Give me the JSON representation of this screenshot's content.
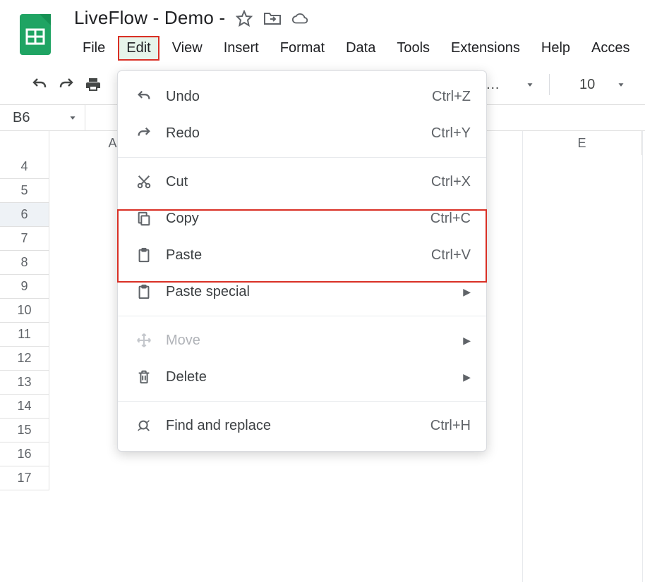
{
  "header": {
    "doc_title": "LiveFlow - Demo -"
  },
  "menubar": {
    "items": [
      "File",
      "Edit",
      "View",
      "Insert",
      "Format",
      "Data",
      "Tools",
      "Extensions",
      "Help",
      "Acces"
    ],
    "active_index": 1
  },
  "toolbar": {
    "font_label": "t (Ari…",
    "font_size": "10"
  },
  "namebox": {
    "value": "B6"
  },
  "columns": {
    "A": "A",
    "E": "E"
  },
  "rows": [
    "4",
    "5",
    "6",
    "7",
    "8",
    "9",
    "10",
    "11",
    "12",
    "13",
    "14",
    "15",
    "16",
    "17"
  ],
  "selected_row": "6",
  "menu": {
    "undo": {
      "label": "Undo",
      "shortcut": "Ctrl+Z"
    },
    "redo": {
      "label": "Redo",
      "shortcut": "Ctrl+Y"
    },
    "cut": {
      "label": "Cut",
      "shortcut": "Ctrl+X"
    },
    "copy": {
      "label": "Copy",
      "shortcut": "Ctrl+C"
    },
    "paste": {
      "label": "Paste",
      "shortcut": "Ctrl+V"
    },
    "paste_special": {
      "label": "Paste special"
    },
    "move": {
      "label": "Move"
    },
    "delete": {
      "label": "Delete"
    },
    "find": {
      "label": "Find and replace",
      "shortcut": "Ctrl+H"
    }
  }
}
